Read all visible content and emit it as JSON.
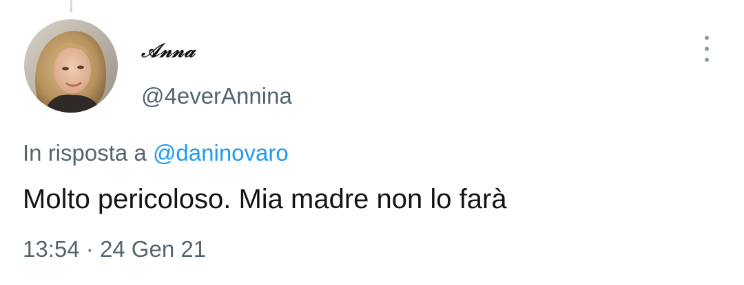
{
  "tweet": {
    "author": {
      "display_name": "𝒜𝓃𝓃𝒶",
      "handle": "@4everAnnina",
      "avatar": "user-photo"
    },
    "reply_context": {
      "prefix": "In risposta a",
      "mention": "@daninovaro"
    },
    "text": "Molto pericoloso. Mia madre non lo farà",
    "timestamp": {
      "time": "13:54",
      "separator": "·",
      "date": "24 Gen 21"
    },
    "more_icon": "more-vertical-icon"
  },
  "colors": {
    "text_primary": "#0f1419",
    "text_secondary": "#536471",
    "link": "#1d9bf0",
    "thread_line": "#cfd9de"
  }
}
